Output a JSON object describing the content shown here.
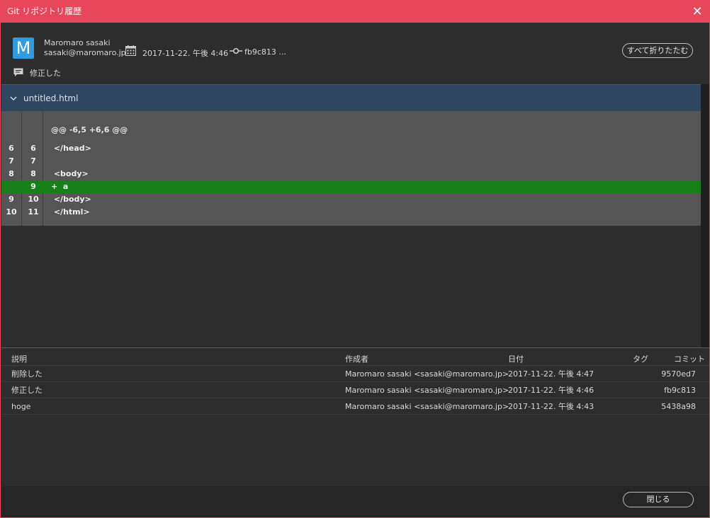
{
  "window": {
    "title": "Git リポジトリ履歴",
    "close_glyph": "✕"
  },
  "commit": {
    "avatar_letter": "M",
    "author_name": "Maromaro sasaki",
    "author_email": "sasaki@maromaro.jp",
    "date": "2017-11-22. 午後 4:46",
    "hash": "fb9c813 ...",
    "message": "修正した",
    "collapse_all_label": "すべて折りたたむ"
  },
  "diff": {
    "file_name": "untitled.html",
    "hunk_header": "@@ -6,5 +6,6 @@",
    "lines": [
      {
        "old": "6",
        "new": "6",
        "code": " </head>",
        "type": "context"
      },
      {
        "old": "7",
        "new": "7",
        "code": "",
        "type": "context"
      },
      {
        "old": "8",
        "new": "8",
        "code": " <body>",
        "type": "context"
      },
      {
        "old": "",
        "new": "9",
        "code": "+  a",
        "type": "added"
      },
      {
        "old": "9",
        "new": "10",
        "code": " </body>",
        "type": "context"
      },
      {
        "old": "10",
        "new": "11",
        "code": " </html>",
        "type": "context"
      }
    ]
  },
  "history": {
    "columns": {
      "description": "説明",
      "author": "作成者",
      "date": "日付",
      "tag": "タグ",
      "commit": "コミット"
    },
    "rows": [
      {
        "description": "削除した",
        "author": "Maromaro sasaki <sasaki@maromaro.jp>",
        "date": "2017-11-22. 午後 4:47",
        "commit": "9570ed7"
      },
      {
        "description": "修正した",
        "author": "Maromaro sasaki <sasaki@maromaro.jp>",
        "date": "2017-11-22. 午後 4:46",
        "commit": "fb9c813"
      },
      {
        "description": "hoge",
        "author": "Maromaro sasaki <sasaki@maromaro.jp>",
        "date": "2017-11-22. 午後 4:43",
        "commit": "5438a98"
      }
    ]
  },
  "footer": {
    "close_label": "閉じる"
  },
  "colors": {
    "titlebar": "#e8465a",
    "avatar": "#2f9be0",
    "file_header": "#2f4661",
    "added_line": "#177f17"
  }
}
